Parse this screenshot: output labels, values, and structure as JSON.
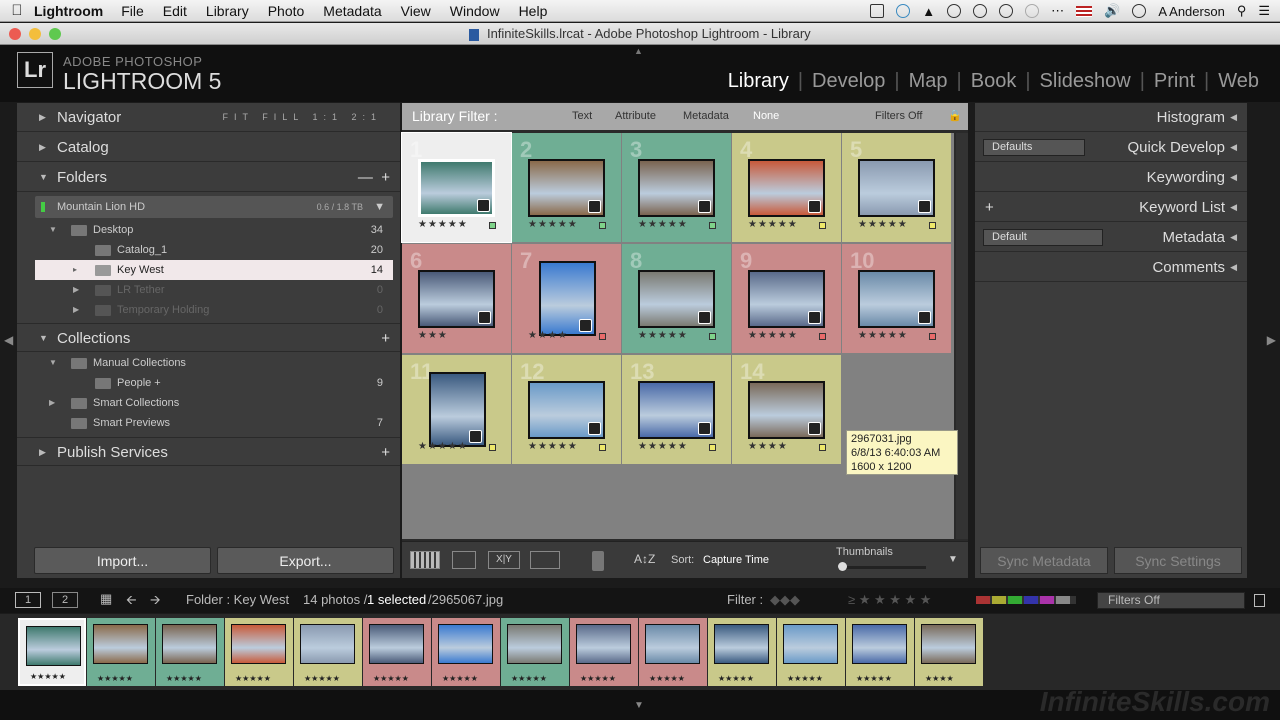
{
  "menubar": {
    "app_name": "Lightroom",
    "items": [
      "File",
      "Edit",
      "Library",
      "Photo",
      "Metadata",
      "View",
      "Window",
      "Help"
    ],
    "user": "A Anderson"
  },
  "window": {
    "title": "InfiniteSkills.lrcat - Adobe Photoshop Lightroom - Library"
  },
  "identity": {
    "logo": "Lr",
    "line1": "ADOBE PHOTOSHOP",
    "line2": "LIGHTROOM 5"
  },
  "modules": [
    "Library",
    "Develop",
    "Map",
    "Book",
    "Slideshow",
    "Print",
    "Web"
  ],
  "active_module": "Library",
  "left": {
    "navigator": {
      "title": "Navigator",
      "options": "FIT  FILL  1:1  2:1"
    },
    "catalog": {
      "title": "Catalog"
    },
    "folders": {
      "title": "Folders",
      "volume": {
        "name": "Mountain Lion HD",
        "size": "0.6 / 1.8 TB"
      },
      "items": [
        {
          "name": "Desktop",
          "count": "34"
        },
        {
          "name": "Catalog_1",
          "count": "20"
        },
        {
          "name": "Key West",
          "count": "14"
        },
        {
          "name": "LR Tether",
          "count": "0"
        },
        {
          "name": "Temporary Holding",
          "count": "0"
        }
      ]
    },
    "collections": {
      "title": "Collections",
      "items": [
        {
          "name": "Manual Collections",
          "count": ""
        },
        {
          "name": "People  +",
          "count": "9"
        },
        {
          "name": "Smart Collections",
          "count": ""
        },
        {
          "name": "Smart Previews",
          "count": "7"
        }
      ]
    },
    "publish": {
      "title": "Publish Services"
    },
    "import_label": "Import...",
    "export_label": "Export..."
  },
  "filterbar": {
    "label": "Library Filter :",
    "options": [
      "Text",
      "Attribute",
      "Metadata",
      "None"
    ],
    "filters_off": "Filters Off"
  },
  "grid": {
    "cells": [
      {
        "bg": "#eeeeee",
        "photo": "#3f7a6e",
        "stars": "★★★★★",
        "label": "#7fd38a",
        "selected": true
      },
      {
        "bg": "#6fae94",
        "photo": "#8a6a4a",
        "stars": "★★★★★",
        "label": "#7fd38a"
      },
      {
        "bg": "#6fae94",
        "photo": "#7a6450",
        "stars": "★★★★★",
        "label": "#7fd38a"
      },
      {
        "bg": "#c9c98a",
        "photo": "#c85a3a",
        "stars": "★★★★★",
        "label": "#eee86a"
      },
      {
        "bg": "#c9c98a",
        "photo": "#8a9ab0",
        "stars": "★★★★★",
        "label": "#eee86a"
      },
      {
        "bg": "#c98a8a",
        "photo": "#4a5a78",
        "stars": "★★★",
        "label": ""
      },
      {
        "bg": "#c98a8a",
        "photo": "#3a7ad0",
        "stars": "★★★★",
        "label": "#e86a6a"
      },
      {
        "bg": "#6fae94",
        "photo": "#7a7a72",
        "stars": "★★★★★",
        "label": "#7fd38a"
      },
      {
        "bg": "#c98a8a",
        "photo": "#5a6a8a",
        "stars": "★★★★★",
        "label": "#e86a6a"
      },
      {
        "bg": "#c98a8a",
        "photo": "#6a8aa8",
        "stars": "★★★★★",
        "label": "#e86a6a"
      },
      {
        "bg": "#c9c98a",
        "photo": "#3a5a80",
        "stars": "★★★★★",
        "label": "#eee86a"
      },
      {
        "bg": "#c9c98a",
        "photo": "#6a9ac8",
        "stars": "★★★★★",
        "label": "#eee86a"
      },
      {
        "bg": "#c9c98a",
        "photo": "#4a6aa8",
        "stars": "★★★★★",
        "label": "#eee86a"
      },
      {
        "bg": "#c9c98a",
        "photo": "#7a6a5a",
        "stars": "★★★★",
        "label": "#eee86a"
      }
    ],
    "tooltip": {
      "filename": "2967031.jpg",
      "date": "6/8/13 6:40:03 AM",
      "dims": "1600 x 1200"
    }
  },
  "toolbar": {
    "sort_label": "Sort:",
    "sort_value": "Capture Time",
    "thumbnails": "Thumbnails"
  },
  "right": {
    "histogram": "Histogram",
    "quick_develop": "Quick Develop",
    "qd_preset": "Defaults",
    "keywording": "Keywording",
    "keyword_list": "Keyword List",
    "metadata": "Metadata",
    "md_preset": "Default",
    "comments": "Comments",
    "sync_metadata": "Sync Metadata",
    "sync_settings": "Sync Settings"
  },
  "statusbar": {
    "page1": "1",
    "page2": "2",
    "folder": "Folder : Key West",
    "count_prefix": "14 photos /",
    "selected": "1 selected",
    "selected_file": "/2965067.jpg",
    "filter_label": "Filter :",
    "filters_off": "Filters Off"
  },
  "filmstrip": {
    "frames": [
      {
        "bg": "#eeeeee",
        "photo": "#3f7a6e",
        "stars": "★★★★★"
      },
      {
        "bg": "#6fae94",
        "photo": "#8a6a4a",
        "stars": "★★★★★"
      },
      {
        "bg": "#6fae94",
        "photo": "#7a6450",
        "stars": "★★★★★"
      },
      {
        "bg": "#c9c98a",
        "photo": "#c85a3a",
        "stars": "★★★★★"
      },
      {
        "bg": "#c9c98a",
        "photo": "#8a9ab0",
        "stars": "★★★★★"
      },
      {
        "bg": "#c98a8a",
        "photo": "#4a5a78",
        "stars": "★★★★★"
      },
      {
        "bg": "#c98a8a",
        "photo": "#3a7ad0",
        "stars": "★★★★★"
      },
      {
        "bg": "#6fae94",
        "photo": "#7a7a72",
        "stars": "★★★★★"
      },
      {
        "bg": "#c98a8a",
        "photo": "#5a6a8a",
        "stars": "★★★★★"
      },
      {
        "bg": "#c98a8a",
        "photo": "#6a8aa8",
        "stars": "★★★★★"
      },
      {
        "bg": "#c9c98a",
        "photo": "#3a5a80",
        "stars": "★★★★★"
      },
      {
        "bg": "#c9c98a",
        "photo": "#6a9ac8",
        "stars": "★★★★★"
      },
      {
        "bg": "#c9c98a",
        "photo": "#4a6aa8",
        "stars": "★★★★★"
      },
      {
        "bg": "#c9c98a",
        "photo": "#7a6a5a",
        "stars": "★★★★"
      }
    ]
  },
  "watermark": "InfiniteSkills.com"
}
